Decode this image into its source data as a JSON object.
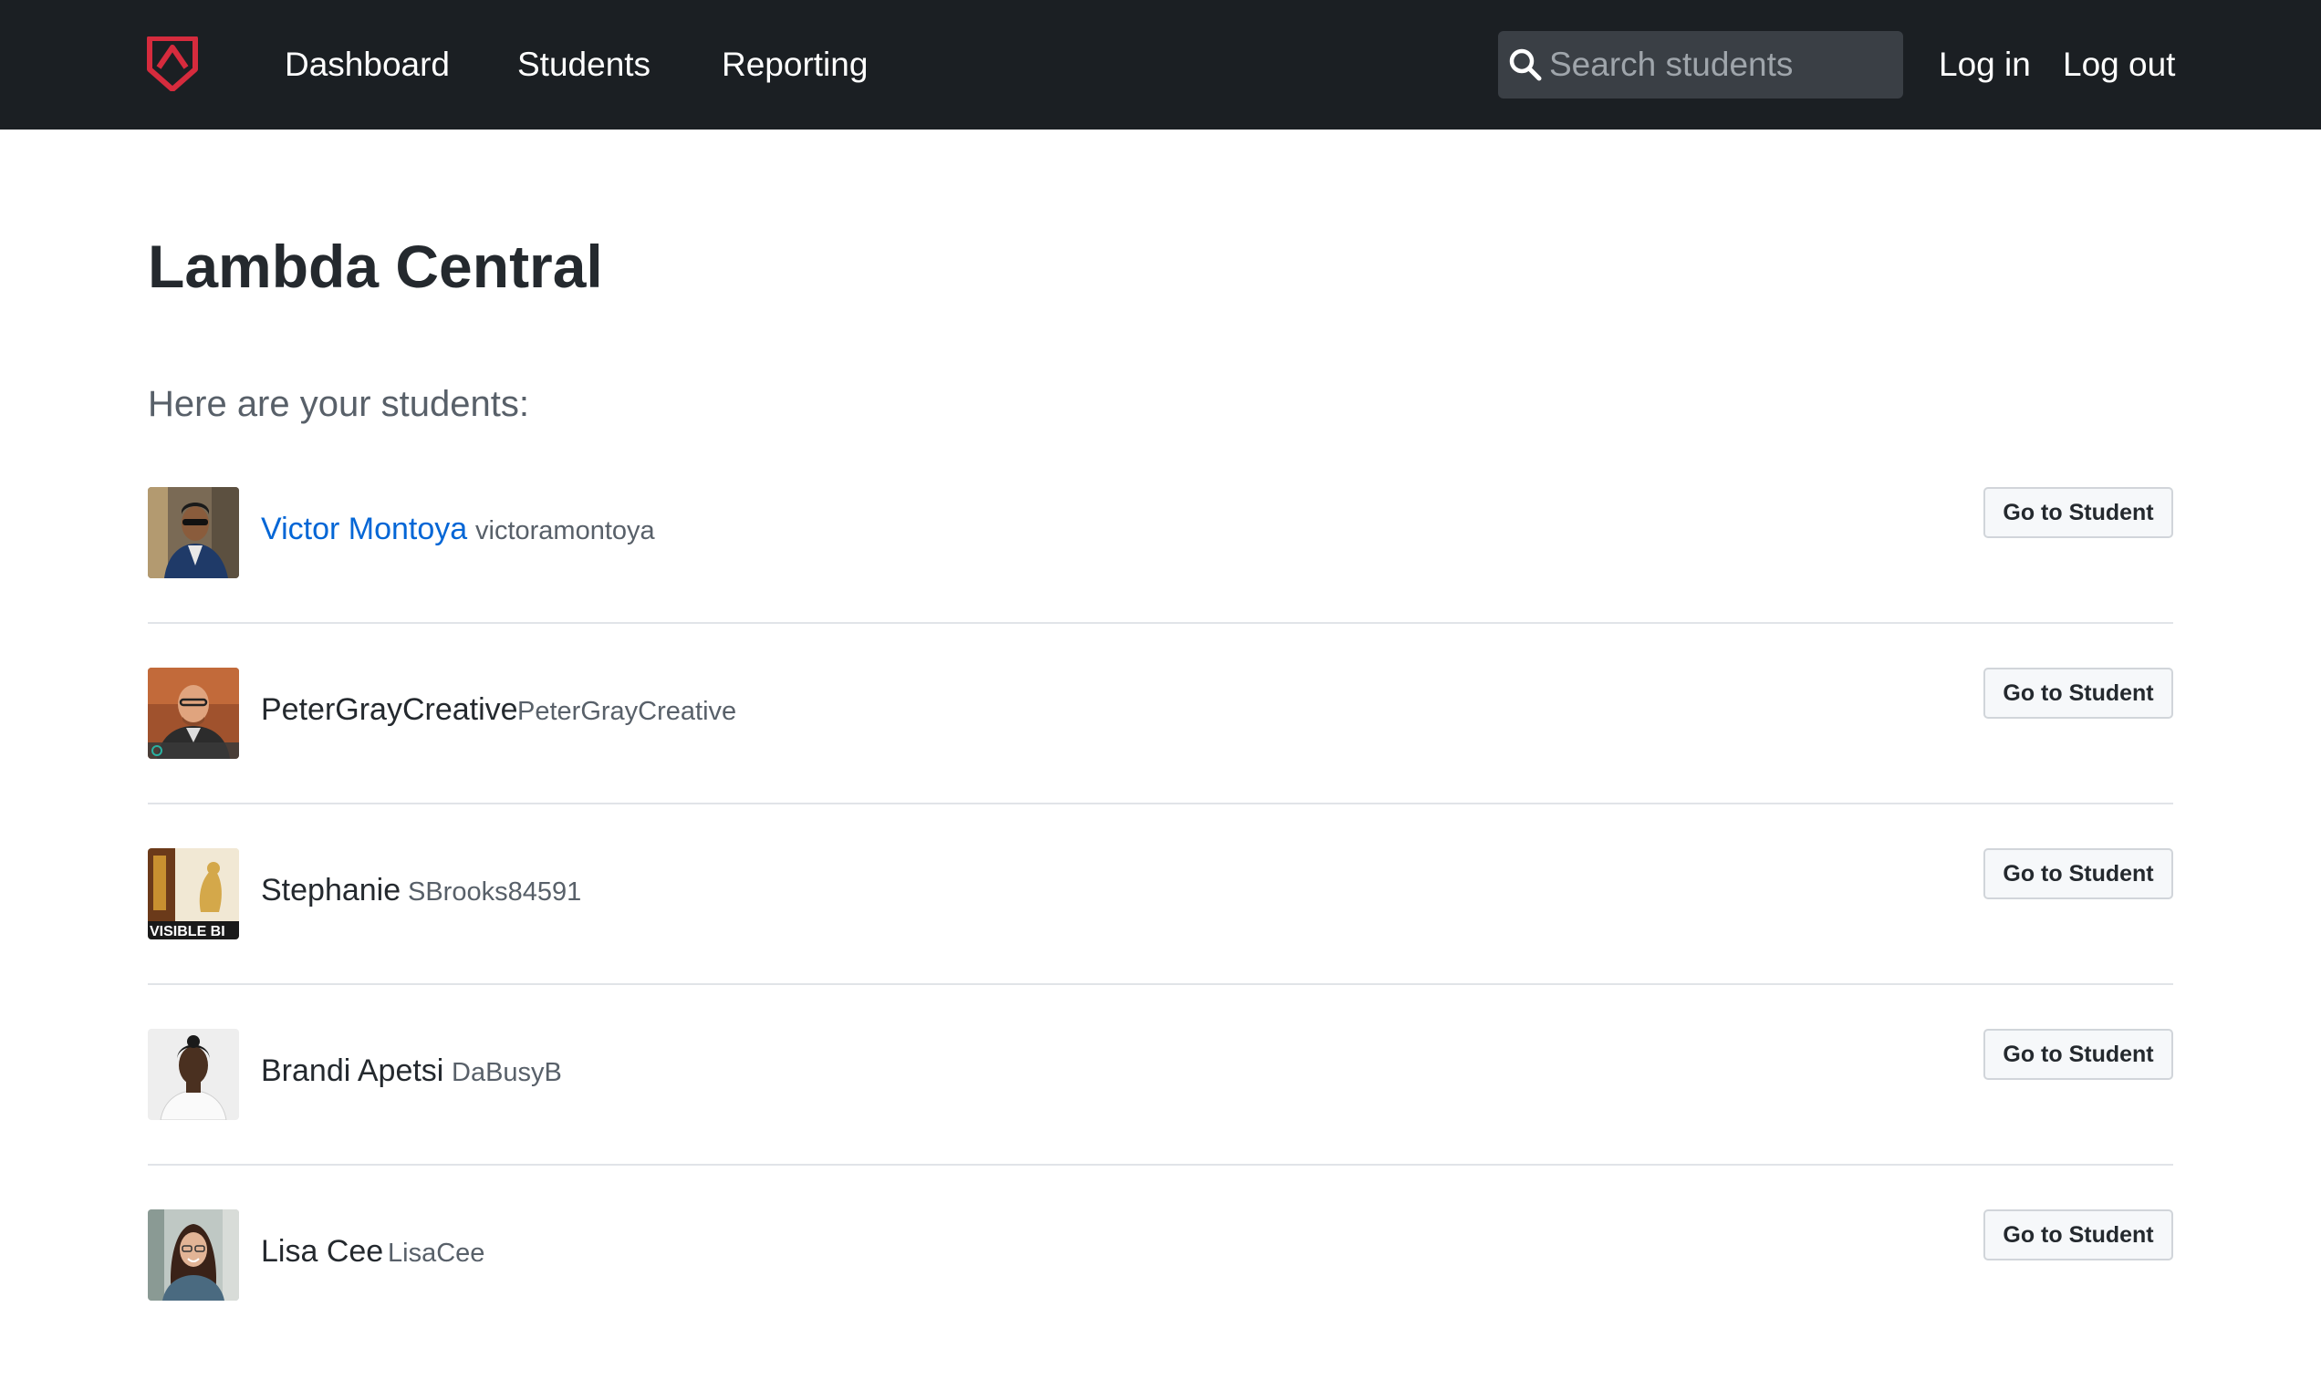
{
  "header": {
    "logo_icon": "lambda-shield-icon",
    "brand_color": "#d62b3d",
    "nav": [
      {
        "label": "Dashboard"
      },
      {
        "label": "Students"
      },
      {
        "label": "Reporting"
      }
    ],
    "search": {
      "placeholder": "Search students",
      "value": "",
      "icon": "search-icon"
    },
    "login_label": "Log in",
    "logout_label": "Log out"
  },
  "main": {
    "title": "Lambda Central",
    "subtitle": "Here are your students:",
    "students": [
      {
        "name": "Victor Montoya",
        "username": "victoramontoya",
        "button": "Go to Student",
        "active": true
      },
      {
        "name": "PeterGrayCreative",
        "username": "PeterGrayCreative",
        "button": "Go to Student",
        "active": false
      },
      {
        "name": "Stephanie",
        "username": "SBrooks84591",
        "button": "Go to Student",
        "active": false,
        "avatar_text": "VISIBLE BI"
      },
      {
        "name": "Brandi Apetsi",
        "username": "DaBusyB",
        "button": "Go to Student",
        "active": false
      },
      {
        "name": "Lisa Cee",
        "username": "LisaCee",
        "button": "Go to Student",
        "active": false
      }
    ]
  },
  "colors": {
    "header_bg": "#1b1f23",
    "link_active": "#0366d6",
    "text_muted": "#586069"
  }
}
